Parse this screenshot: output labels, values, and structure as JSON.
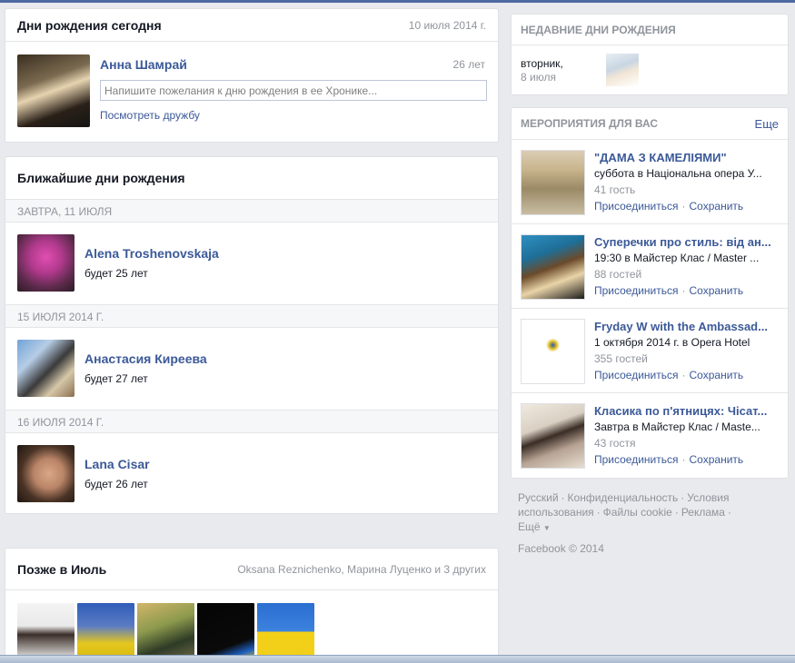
{
  "today": {
    "title": "Дни рождения сегодня",
    "date": "10 июля 2014 г.",
    "person": {
      "name": "Анна Шамрай",
      "age": "26 лет",
      "wish_placeholder": "Напишите пожелания к дню рождения в ее Хронике...",
      "friendship_link": "Посмотреть дружбу"
    }
  },
  "upcoming": {
    "title": "Ближайшие дни рождения",
    "groups": [
      {
        "date": "ЗАВТРА, 11 ИЮЛЯ",
        "person": {
          "name": "Alena Troshenovskaja",
          "age": "будет 25 лет"
        }
      },
      {
        "date": "15 ИЮЛЯ 2014 Г.",
        "person": {
          "name": "Анастасия Киреева",
          "age": "будет 27 лет"
        }
      },
      {
        "date": "16 ИЮЛЯ 2014 Г.",
        "person": {
          "name": "Lana Cisar",
          "age": "будет 26 лет"
        }
      }
    ]
  },
  "later": {
    "title": "Позже в Июль",
    "names": "Oksana Reznichenko, Марина Луценко и 3 других"
  },
  "recent": {
    "title": "НЕДАВНИЕ ДНИ РОЖДЕНИЯ",
    "day": "вторник,",
    "date": "8 июля"
  },
  "events": {
    "title": "МЕРОПРИЯТИЯ ДЛЯ ВАС",
    "more": "Еще",
    "join_label": "Присоединиться",
    "save_label": "Сохранить",
    "items": [
      {
        "title": "\"ДАМА З КАМЕЛІЯМИ\"",
        "when": "суббота в Національна опера У...",
        "guests": "41 гость"
      },
      {
        "title": "Суперечки про стиль: від ан...",
        "when": "19:30 в Майстер Клас / Master ...",
        "guests": "88 гостей"
      },
      {
        "title": "Fryday W with the Ambassad...",
        "when": "1 октября 2014 г. в Opera Hotel",
        "guests": "355 гостей"
      },
      {
        "title": "Класика по п'ятницях: Чісат...",
        "when": "Завтра в Майстер Клас / Maste...",
        "guests": "43 гостя"
      }
    ]
  },
  "footer": {
    "language": "Русский",
    "privacy": "Конфиденциальность",
    "terms": "Условия использования",
    "cookies": "Файлы cookie",
    "ads": "Реклама",
    "more": "Ещё",
    "copyright": "Facebook © 2014"
  }
}
